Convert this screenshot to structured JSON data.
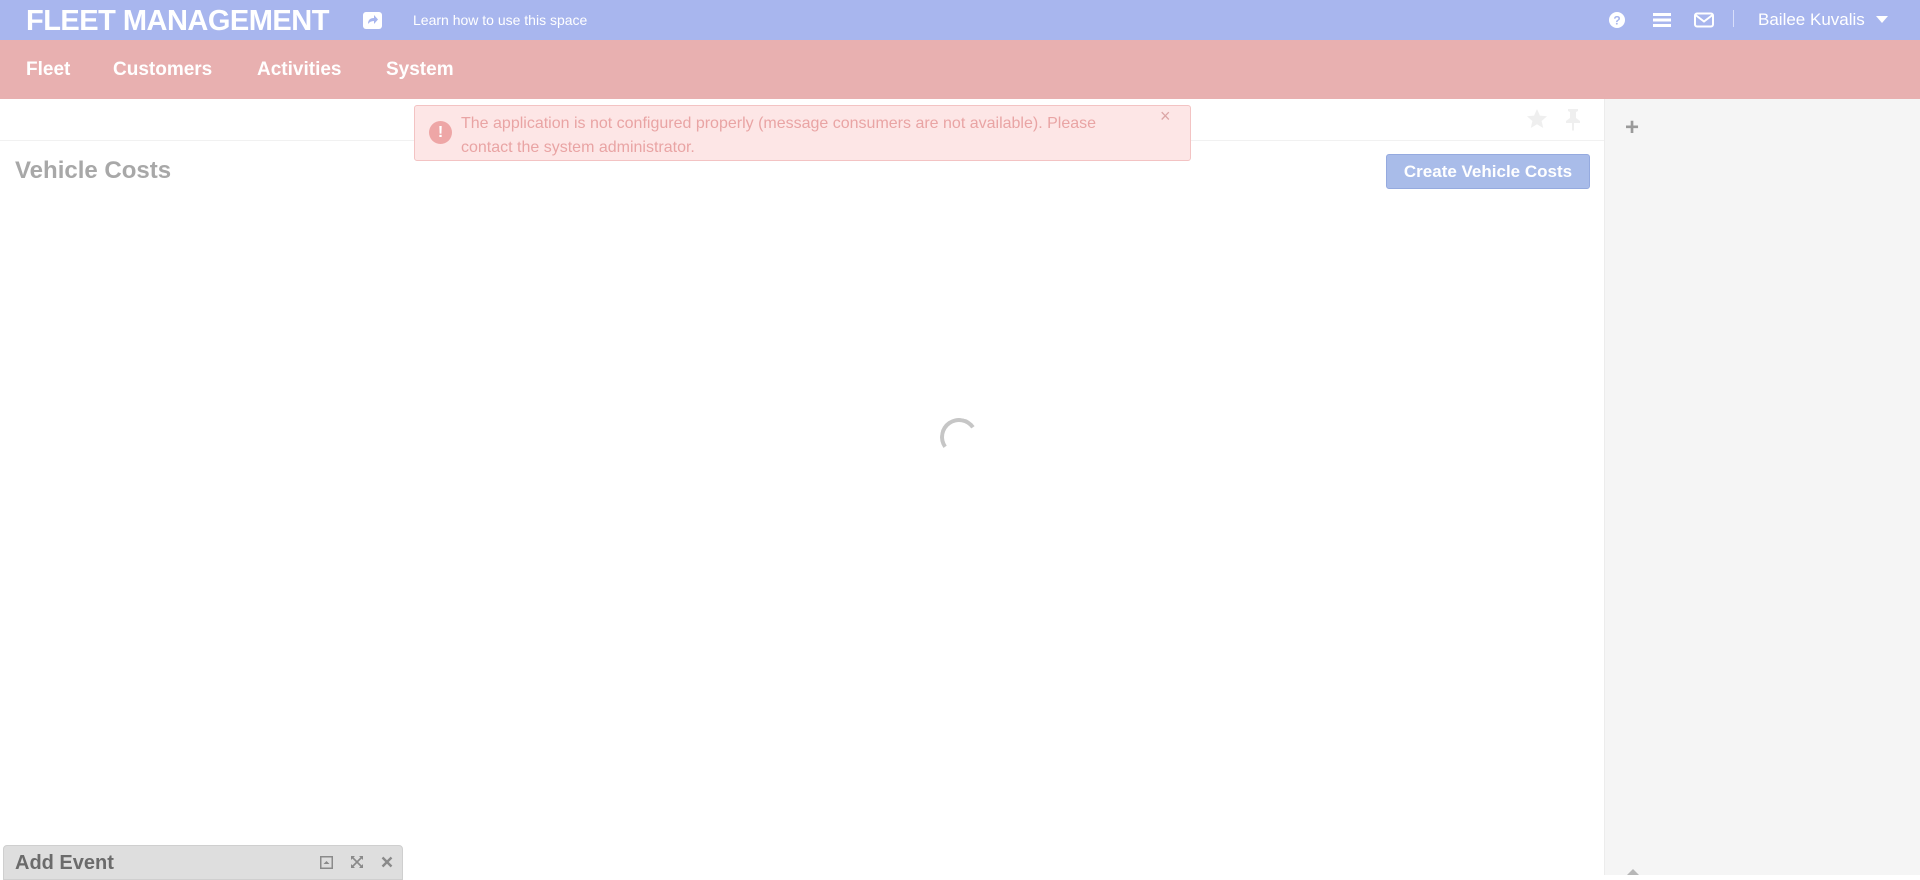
{
  "header": {
    "app_title": "FLEET MANAGEMENT",
    "help_link_label": "Learn how to use this space",
    "user_name": "Bailee Kuvalis",
    "icons": [
      "question-circle-icon",
      "bars-icon",
      "envelope-icon",
      "share-icon",
      "caret-down-icon"
    ]
  },
  "nav": {
    "items": [
      {
        "label": "Fleet"
      },
      {
        "label": "Customers"
      },
      {
        "label": "Activities"
      },
      {
        "label": "System"
      }
    ]
  },
  "alert": {
    "message": "The application is not configured properly (message consumers are not available). Please contact the system administrator.",
    "icon_glyph": "!",
    "close_glyph": "×"
  },
  "page": {
    "title": "Vehicle Costs",
    "create_button_label": "Create Vehicle Costs",
    "icons": [
      "star-icon",
      "pin-icon"
    ]
  },
  "sidebar": {
    "add_glyph": "+"
  },
  "add_event_panel": {
    "title": "Add Event",
    "icons": [
      "minimize-icon",
      "expand-icon",
      "close-icon"
    ]
  },
  "colors": {
    "topbar": "#a8b6ee",
    "navbar": "#e8b0b0",
    "alert_bg": "#fde6e6",
    "alert_text": "#e9a4a4",
    "primary_button": "#a9bce9",
    "title_text": "#a8a8a8"
  }
}
